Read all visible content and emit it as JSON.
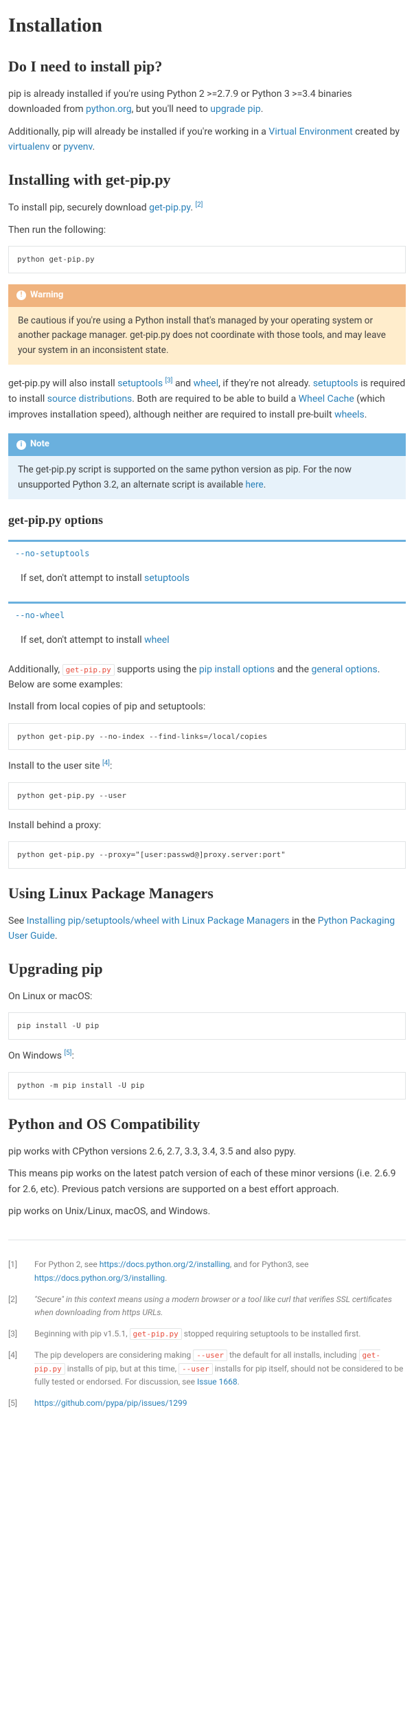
{
  "title": "Installation",
  "s1": {
    "heading": "Do I need to install pip?",
    "p1a": "pip is already installed if you're using Python 2 >=2.7.9 or Python 3 >=3.4 binaries downloaded from ",
    "p1_link1": "python.org",
    "p1b": ", but you'll need to ",
    "p1_link2": "upgrade pip",
    "p1c": ".",
    "p2a": "Additionally, pip will already be installed if you're working in a ",
    "p2_link1": "Virtual Environment",
    "p2b": " created by ",
    "p2_link2": "virtualenv",
    "p2c": " or ",
    "p2_link3": "pyvenv",
    "p2d": "."
  },
  "s2": {
    "heading": "Installing with get-pip.py",
    "p1a": "To install pip, securely download ",
    "p1_link": "get-pip.py",
    "p1b": ". ",
    "p1_fn": "[2]",
    "p2": "Then run the following:",
    "code1": "python get-pip.py",
    "warn_title": "Warning",
    "warn_body": "Be cautious if you're using a Python install that's managed by your operating system or another package manager. get-pip.py does not coordinate with those tools, and may leave your system in an inconsistent state.",
    "p3a": "get-pip.py will also install ",
    "p3_link1": "setuptools",
    "p3_fn1": "[3]",
    "p3b": " and ",
    "p3_link2": "wheel",
    "p3c": ", if they're not already. ",
    "p3_link3": "setuptools",
    "p3d": " is required to install ",
    "p3_link4": "source distributions",
    "p3e": ". Both are required to be able to build a ",
    "p3_link5": "Wheel Cache",
    "p3f": " (which improves installation speed), although neither are required to install pre-built ",
    "p3_link6": "wheels",
    "p3g": ".",
    "note_title": "Note",
    "note_a": "The get-pip.py script is supported on the same python version as pip. For the now unsupported Python 3.2, an alternate script is available ",
    "note_link": "here",
    "note_b": "."
  },
  "s3": {
    "heading": "get-pip.py options",
    "opt1": "--no-setuptools",
    "opt1_desc_a": "If set, don't attempt to install ",
    "opt1_desc_link": "setuptools",
    "opt2": "--no-wheel",
    "opt2_desc_a": "If set, don't attempt to install ",
    "opt2_desc_link": "wheel",
    "p1a": "Additionally, ",
    "p1_code": "get-pip.py",
    "p1b": " supports using the ",
    "p1_link1": "pip install options",
    "p1c": " and the ",
    "p1_link2": "general options",
    "p1d": ". Below are some examples:",
    "p2": "Install from local copies of pip and setuptools:",
    "code1": "python get-pip.py --no-index --find-links=/local/copies",
    "p3a": "Install to the user site ",
    "p3_fn": "[4]",
    "p3b": ":",
    "code2": "python get-pip.py --user",
    "p4": "Install behind a proxy:",
    "code3": "python get-pip.py --proxy=\"[user:passwd@]proxy.server:port\""
  },
  "s4": {
    "heading": "Using Linux Package Managers",
    "p1a": "See ",
    "p1_link1": "Installing pip/setuptools/wheel with Linux Package Managers",
    "p1b": " in the ",
    "p1_link2": "Python Packaging User Guide",
    "p1c": "."
  },
  "s5": {
    "heading": "Upgrading pip",
    "p1": "On Linux or macOS:",
    "code1": "pip install -U pip",
    "p2a": "On Windows ",
    "p2_fn": "[5]",
    "p2b": ":",
    "code2": "python -m pip install -U pip"
  },
  "s6": {
    "heading": "Python and OS Compatibility",
    "p1": "pip works with CPython versions 2.6, 2.7, 3.3, 3.4, 3.5 and also pypy.",
    "p2": "This means pip works on the latest patch version of each of these minor versions (i.e. 2.6.9 for 2.6, etc). Previous patch versions are supported on a best effort approach.",
    "p3": "pip works on Unix/Linux, macOS, and Windows."
  },
  "fn": {
    "l1": "[1]",
    "t1a": "For Python 2, see ",
    "t1_link1": "https://docs.python.org/2/installing",
    "t1b": ", and for Python3, see ",
    "t1_link2": "https://docs.python.org/3/installing",
    "t1c": ".",
    "l2": "[2]",
    "t2": "\"Secure\" in this context means using a modern browser or a tool like curl that verifies SSL certificates when downloading from https URLs.",
    "l3": "[3]",
    "t3a": "Beginning with pip v1.5.1, ",
    "t3_code": "get-pip.py",
    "t3b": " stopped requiring setuptools to be installed first.",
    "l4": "[4]",
    "t4a": "The pip developers are considering making ",
    "t4_code1": "--user",
    "t4b": " the default for all installs, including ",
    "t4_code2": "get-pip.py",
    "t4c": " installs of pip, but at this time, ",
    "t4_code3": "--user",
    "t4d": " installs for pip itself, should not be considered to be fully tested or endorsed. For discussion, see ",
    "t4_link": "Issue 1668",
    "t4e": ".",
    "l5": "[5]",
    "t5_link": "https://github.com/pypa/pip/issues/1299"
  }
}
